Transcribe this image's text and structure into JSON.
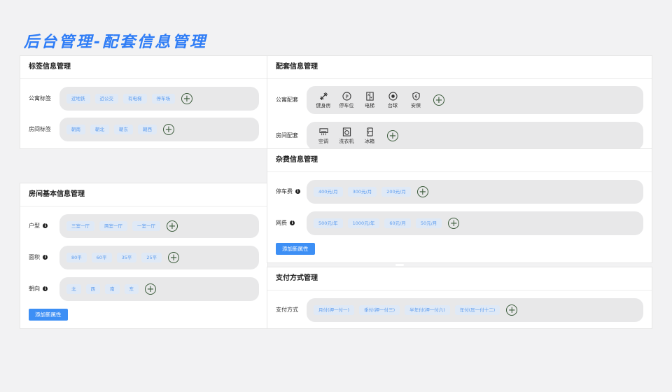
{
  "page_title": "后台管理-配套信息管理",
  "tag_card": {
    "title": "标签信息管理",
    "rows": [
      {
        "label": "公寓标签",
        "chips": [
          "近地铁",
          "近公交",
          "有电梯",
          "停车场"
        ]
      },
      {
        "label": "房间标签",
        "chips": [
          "朝南",
          "朝北",
          "朝东",
          "朝西"
        ]
      }
    ]
  },
  "room_card": {
    "title": "房间基本信息管理",
    "rows": [
      {
        "label": "户型",
        "chips": [
          "三室一厅",
          "两室一厅",
          "一室一厅"
        ]
      },
      {
        "label": "面积",
        "chips": [
          "80平",
          "60平",
          "35平",
          "25平"
        ]
      },
      {
        "label": "朝向",
        "chips": [
          "北",
          "西",
          "南",
          "东"
        ]
      }
    ],
    "add_button": "添加新属性"
  },
  "facility_card": {
    "title": "配套信息管理",
    "rows": [
      {
        "label": "公寓配套",
        "items": [
          {
            "icon": "dumbbell-icon",
            "label": "健身房"
          },
          {
            "icon": "parking-icon",
            "label": "停车位"
          },
          {
            "icon": "elevator-icon",
            "label": "电梯"
          },
          {
            "icon": "billiards-icon",
            "label": "台球"
          },
          {
            "icon": "security-shield-icon",
            "label": "安保"
          }
        ]
      },
      {
        "label": "房间配套",
        "items": [
          {
            "icon": "air-conditioner-icon",
            "label": "空调"
          },
          {
            "icon": "washing-machine-icon",
            "label": "洗衣机"
          },
          {
            "icon": "fridge-icon",
            "label": "冰箱"
          }
        ]
      }
    ]
  },
  "fee_card": {
    "title": "杂费信息管理",
    "rows": [
      {
        "label": "停车费",
        "chips": [
          "400元/月",
          "300元/月",
          "200元/月"
        ]
      },
      {
        "label": "网费",
        "chips": [
          "500元/年",
          "1000元/年",
          "60元/月",
          "50元/月"
        ]
      }
    ],
    "add_button": "添加新属性"
  },
  "payment_card": {
    "title": "支付方式管理",
    "rows": [
      {
        "label": "支付方式",
        "chips": [
          "月付(押一付一)",
          "季付(押一付三)",
          "半年付(押一付六)",
          "年付(压一付十二)"
        ]
      }
    ]
  }
}
